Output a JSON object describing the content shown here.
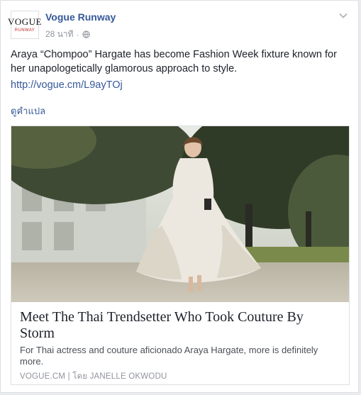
{
  "post": {
    "page_name": "Vogue Runway",
    "avatar": {
      "logo_main": "VOGUE",
      "logo_sub": "RUNWAY"
    },
    "timestamp": "28 นาที",
    "separator": "·",
    "privacy_icon": "globe-icon",
    "menu_icon": "chevron-down-icon",
    "text": "Araya “Chompoo” Hargate has become Fashion Week fixture known for her unapologetically glamorous approach to style.",
    "link": "http://vogue.cm/L9ayTOj",
    "translate_label": "ดูคำแปล"
  },
  "card": {
    "title": "Meet The Thai Trendsetter Who Took Couture By Storm",
    "description": "For Thai actress and couture aficionado Araya Hargate, more is definitely more.",
    "source": "VOGUE.CM | โดย JANELLE OKWODU"
  },
  "colors": {
    "link": "#365899",
    "meta": "#90949c",
    "text": "#1d2129",
    "border": "#dddfe2",
    "background": "#e9ebee"
  }
}
